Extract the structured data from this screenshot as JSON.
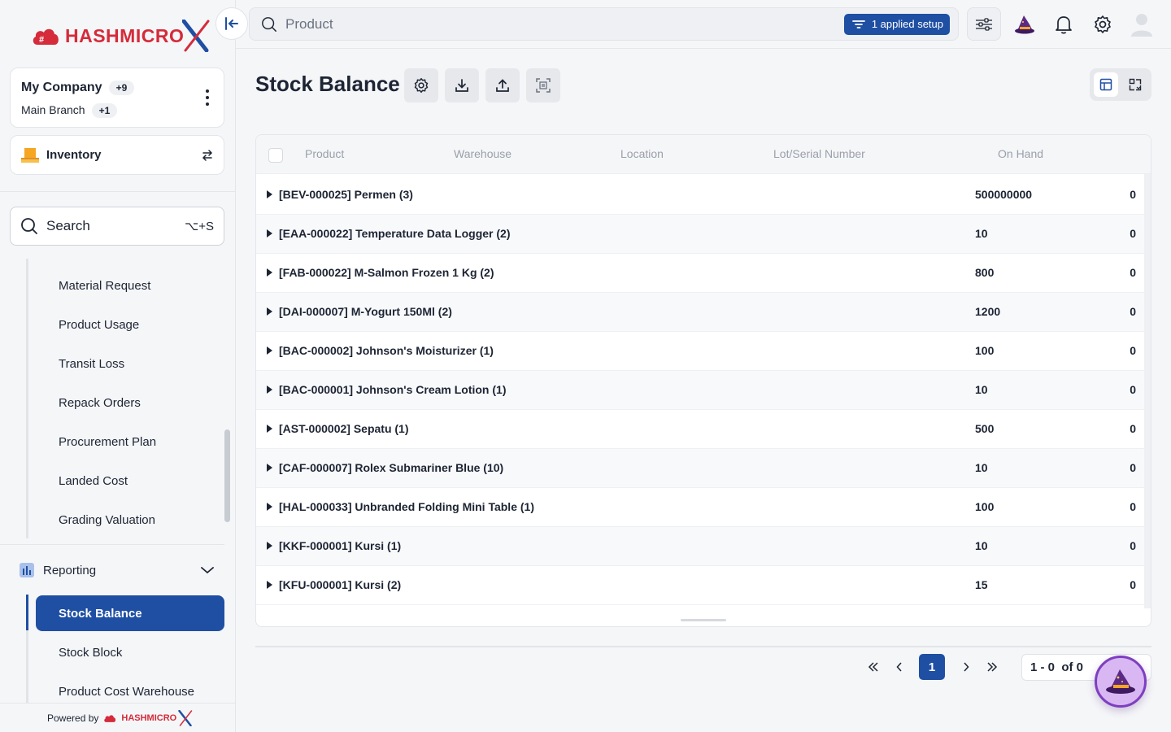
{
  "brand": {
    "logo_text_bold": "HASHMICRO",
    "logo_text_accent": "X",
    "primary_color": "#1f4fa3",
    "accent_color": "#d52b3a"
  },
  "sidebar": {
    "company": {
      "name": "My Company",
      "name_badge": "+9",
      "branch": "Main Branch",
      "branch_badge": "+1"
    },
    "module": {
      "label": "Inventory"
    },
    "search": {
      "label": "Search",
      "shortcut": "⌥+S"
    },
    "items": [
      {
        "label": "Material Request"
      },
      {
        "label": "Product Usage"
      },
      {
        "label": "Transit Loss"
      },
      {
        "label": "Repack Orders"
      },
      {
        "label": "Procurement Plan"
      },
      {
        "label": "Landed Cost"
      },
      {
        "label": "Grading Valuation"
      }
    ],
    "section": {
      "label": "Reporting"
    },
    "report_items": [
      {
        "label": "Stock Balance",
        "active": true
      },
      {
        "label": "Stock Block"
      },
      {
        "label": "Product Cost Warehouse"
      }
    ],
    "powered_by": "Powered by",
    "powered_brand": "HASHMICRO"
  },
  "topbar": {
    "search_placeholder": "Product",
    "applied_label": "1 applied setup"
  },
  "page": {
    "title": "Stock Balance"
  },
  "table": {
    "columns": [
      "Product",
      "Warehouse",
      "Location",
      "Lot/Serial Number",
      "On Hand"
    ],
    "rows": [
      {
        "product": "[BEV-000025] Permen (3)",
        "qty": "500000000",
        "onhand": "0"
      },
      {
        "product": "[EAA-000022] Temperature Data Logger (2)",
        "qty": "10",
        "onhand": "0"
      },
      {
        "product": "[FAB-000022] M-Salmon Frozen 1 Kg (2)",
        "qty": "800",
        "onhand": "0"
      },
      {
        "product": "[DAI-000007] M-Yogurt 150Ml (2)",
        "qty": "1200",
        "onhand": "0"
      },
      {
        "product": "[BAC-000002] Johnson's Moisturizer (1)",
        "qty": "100",
        "onhand": "0"
      },
      {
        "product": "[BAC-000001] Johnson's Cream Lotion (1)",
        "qty": "10",
        "onhand": "0"
      },
      {
        "product": "[AST-000002] Sepatu (1)",
        "qty": "500",
        "onhand": "0"
      },
      {
        "product": "[CAF-000007] Rolex Submariner Blue (10)",
        "qty": "10",
        "onhand": "0"
      },
      {
        "product": "[HAL-000033] Unbranded Folding Mini Table (1)",
        "qty": "100",
        "onhand": "0"
      },
      {
        "product": "[KKF-000001] Kursi (1)",
        "qty": "10",
        "onhand": "0"
      },
      {
        "product": "[KFU-000001] Kursi (2)",
        "qty": "15",
        "onhand": "0"
      }
    ]
  },
  "pagination": {
    "current_page": "1",
    "range_text": "1 - 0  of 0"
  }
}
